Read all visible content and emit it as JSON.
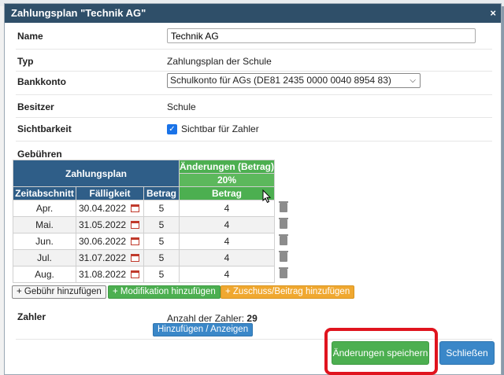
{
  "dialog": {
    "title": "Zahlungsplan \"Technik AG\"",
    "close_label": "×"
  },
  "form": {
    "name_label": "Name",
    "name_value": "Technik AG",
    "typ_label": "Typ",
    "typ_value": "Zahlungsplan der Schule",
    "bankkonto_label": "Bankkonto",
    "bankkonto_value": "Schulkonto für AGs (DE81 2435 0000 0040 8954 83)",
    "besitzer_label": "Besitzer",
    "besitzer_value": "Schule",
    "sichtbarkeit_label": "Sichtbarkeit",
    "sichtbarkeit_checkbox_label": "Sichtbar für Zahler",
    "sichtbarkeit_checked": true,
    "gebuehren_label": "Gebühren"
  },
  "fees_table": {
    "group_header_plan": "Zahlungsplan",
    "group_header_change": "Änderungen (Betrag)",
    "change_percent": "20%",
    "col_period": "Zeitabschnitt",
    "col_due": "Fälligkeit",
    "col_amount": "Betrag",
    "col_change_amount": "Betrag",
    "rows": [
      {
        "period": "Apr.",
        "due": "30.04.2022",
        "amount": "5",
        "change": "4"
      },
      {
        "period": "Mai.",
        "due": "31.05.2022",
        "amount": "5",
        "change": "4"
      },
      {
        "period": "Jun.",
        "due": "30.06.2022",
        "amount": "5",
        "change": "4"
      },
      {
        "period": "Jul.",
        "due": "31.07.2022",
        "amount": "5",
        "change": "4"
      },
      {
        "period": "Aug.",
        "due": "31.08.2022",
        "amount": "5",
        "change": "4"
      }
    ]
  },
  "fee_buttons": {
    "add_fee": "+ Gebühr hinzufügen",
    "add_modification": "+ Modifikation hinzufügen",
    "add_surcharge": "+ Zuschuss/Beitrag hinzufügen"
  },
  "zahler": {
    "label": "Zahler",
    "count_label": "Anzahl der Zahler:",
    "count_value": "29",
    "add_show_button": "Hinzufügen / Anzeigen"
  },
  "footer": {
    "save_button": "Änderungen speichern",
    "close_button": "Schließen"
  },
  "colors": {
    "titlebar": "#2f4f69",
    "table_header_dark": "#2f5e88",
    "table_header_green": "#4caf50",
    "save_button": "#4caf50",
    "close_button": "#3a87c8",
    "highlight": "#e0141e"
  }
}
